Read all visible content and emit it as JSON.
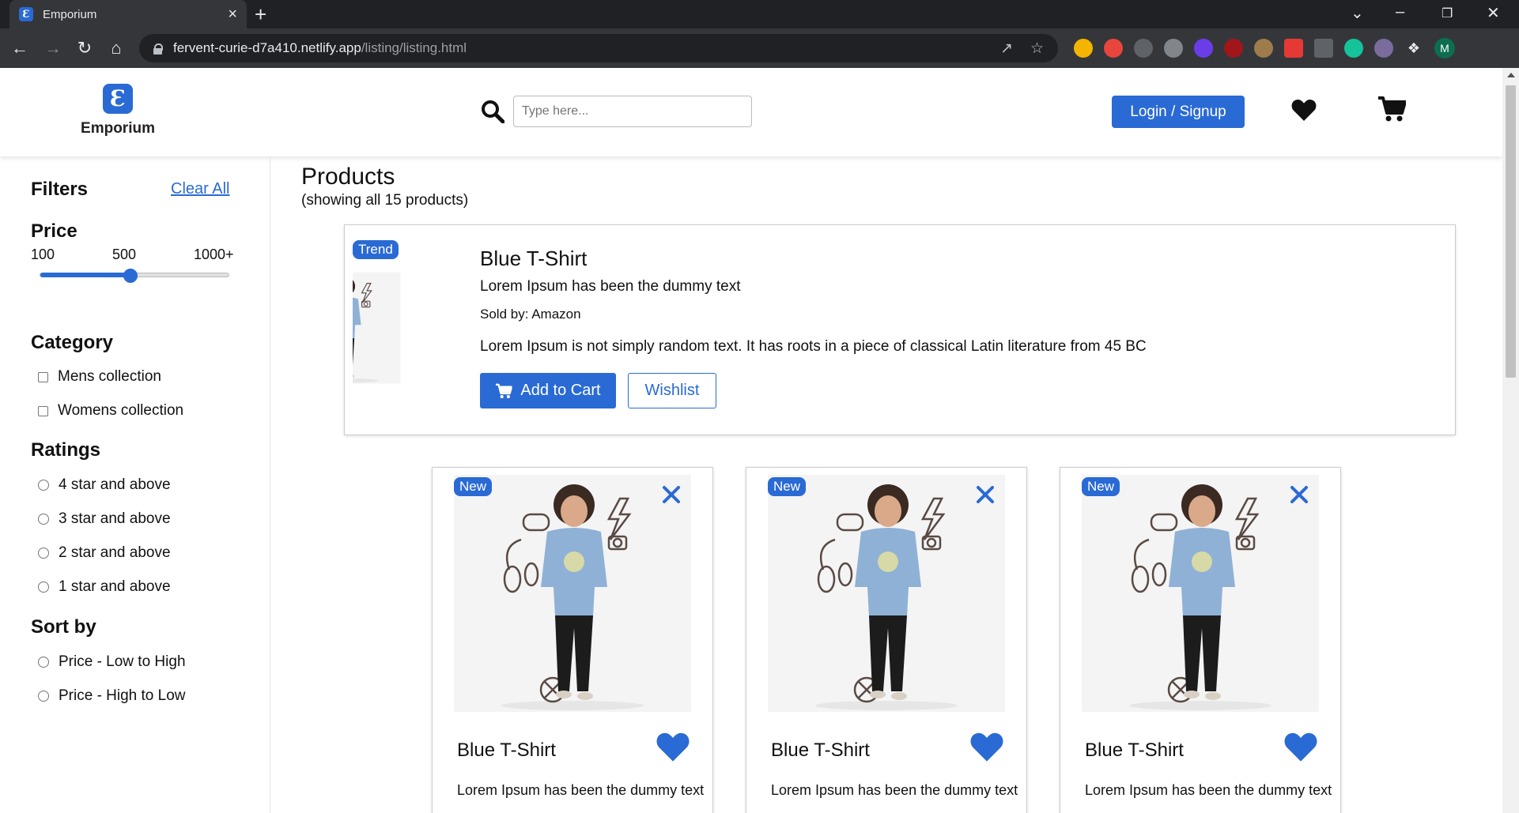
{
  "browser": {
    "tab_title": "Emporium",
    "url_host": "fervent-curie-d7a410.netlify.app",
    "url_path": "/listing/listing.html",
    "profile_initial": "M"
  },
  "colors": {
    "brand": "#2a6ad4",
    "chrome_dark": "#202124",
    "chrome_mid": "#35363a"
  },
  "header": {
    "logo_text": "Emporium",
    "search_placeholder": "Type here...",
    "login_label": "Login / Signup"
  },
  "filters": {
    "title": "Filters",
    "clear_all": "Clear All",
    "price": {
      "title": "Price",
      "min_label": "100",
      "mid_label": "500",
      "max_label": "1000+",
      "value_fraction": 0.48
    },
    "category": {
      "title": "Category",
      "options": [
        "Mens collection",
        "Womens collection"
      ]
    },
    "ratings": {
      "title": "Ratings",
      "options": [
        "4 star and above",
        "3 star and above",
        "2 star and above",
        "1 star and above"
      ]
    },
    "sort": {
      "title": "Sort by",
      "options": [
        "Price - Low to High",
        "Price - High to Low"
      ]
    }
  },
  "products": {
    "title": "Products",
    "subtitle": "(showing all 15 products)",
    "featured": {
      "badge": "Trend",
      "title": "Blue T-Shirt",
      "subtitle": "Lorem Ipsum has been the dummy text",
      "seller": "Sold by: Amazon",
      "description": "Lorem Ipsum is not simply random text. It has roots in a piece of classical Latin literature from 45 BC",
      "add_to_cart": "Add to Cart",
      "wishlist": "Wishlist"
    },
    "cards": [
      {
        "badge": "New",
        "title": "Blue T-Shirt",
        "subtitle": "Lorem Ipsum has been the dummy text"
      },
      {
        "badge": "New",
        "title": "Blue T-Shirt",
        "subtitle": "Lorem Ipsum has been the dummy text"
      },
      {
        "badge": "New",
        "title": "Blue T-Shirt",
        "subtitle": "Lorem Ipsum has been the dummy text"
      }
    ]
  }
}
